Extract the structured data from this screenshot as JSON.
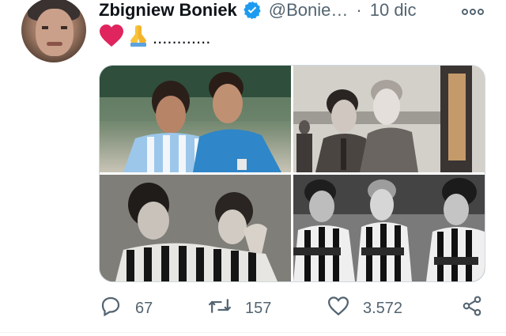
{
  "tweet": {
    "author_name": "Zbigniew Boniek",
    "handle": "@Bonie…",
    "separator": "·",
    "time": "10 dic",
    "text_dots": "............"
  },
  "icons": {
    "verified": "verified-badge-icon",
    "more": "more-options-icon",
    "heart_emoji": "red-heart-emoji",
    "pray_emoji": "folded-hands-emoji"
  },
  "actions": {
    "replies": "67",
    "retweets": "157",
    "likes": "3.572"
  },
  "colors": {
    "verified": "#1d9bf0",
    "secondary_text": "#536471",
    "heart": "#e0245e"
  }
}
